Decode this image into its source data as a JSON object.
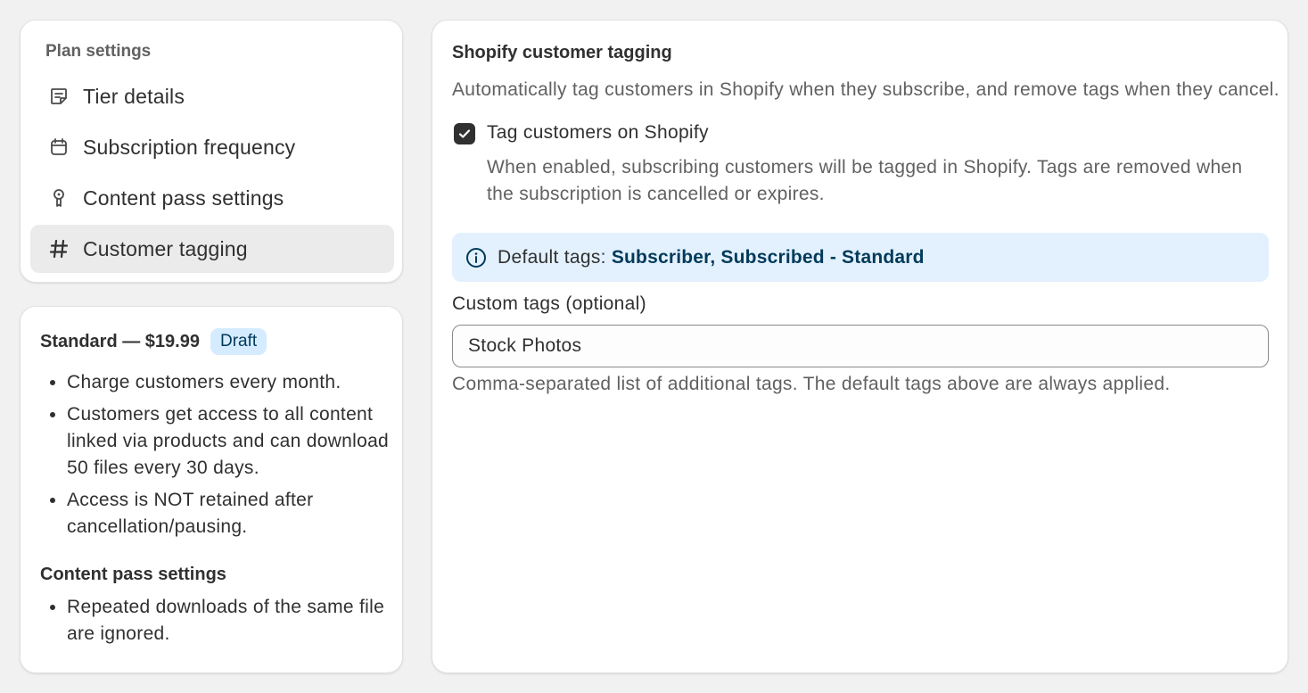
{
  "nav": {
    "heading": "Plan settings",
    "items": [
      {
        "label": "Tier details",
        "icon": "note-icon",
        "active": false
      },
      {
        "label": "Subscription frequency",
        "icon": "calendar-icon",
        "active": false
      },
      {
        "label": "Content pass settings",
        "icon": "key-icon",
        "active": false
      },
      {
        "label": "Customer tagging",
        "icon": "hashtag-icon",
        "active": true
      }
    ]
  },
  "summary": {
    "title": "Standard — $19.99",
    "badge": "Draft",
    "bullets": [
      "Charge customers every month.",
      "Customers get access to all content linked via products and can download 50 files every 30 days.",
      "Access is NOT retained after cancellation/pausing."
    ],
    "content_pass_heading": "Content pass settings",
    "content_pass_bullets": [
      "Repeated downloads of the same file are ignored."
    ]
  },
  "tagging": {
    "title": "Shopify customer tagging",
    "description": "Automatically tag customers in Shopify when they subscribe, and remove tags when they cancel.",
    "checkbox_label": "Tag customers on Shopify",
    "checkbox_checked": true,
    "checkbox_help": "When enabled, subscribing customers will be tagged in Shopify. Tags are removed when the subscription is cancelled or expires.",
    "banner_label": "Default tags:",
    "banner_value": "Subscriber, Subscribed - Standard",
    "custom_label": "Custom tags (optional)",
    "custom_value": "Stock Photos",
    "custom_help": "Comma-separated list of additional tags. The default tags above are always applied."
  },
  "colors": {
    "background": "#f1f1f1",
    "card": "#ffffff",
    "active_nav": "#ebebeb",
    "banner": "#e3f1fe",
    "badge": "#d5ebff",
    "accent_text": "#003a5a"
  }
}
